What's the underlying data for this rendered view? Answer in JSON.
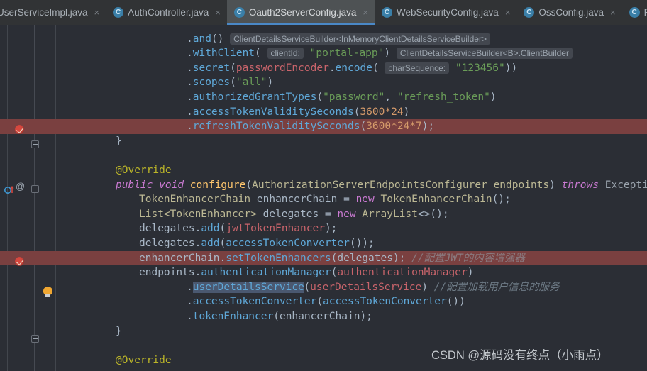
{
  "window": {
    "app": "IntelliJ IDEA",
    "theme_accent": "#4a88c7",
    "editor_background": "#2b2e35",
    "tabbar_background": "#313335",
    "breakpoint_line_color": "#7a4040"
  },
  "tabbar": {
    "tabs": [
      {
        "label": "UserServiceImpl.java",
        "icon": "java-class-icon",
        "icon_letter": "C",
        "active": false,
        "close_label": "×",
        "truncated_left": true
      },
      {
        "label": "AuthController.java",
        "icon": "java-class-icon",
        "icon_letter": "C",
        "active": false,
        "close_label": "×",
        "truncated_left": false
      },
      {
        "label": "Oauth2ServerConfig.java",
        "icon": "java-class-icon",
        "icon_letter": "C",
        "active": true,
        "close_label": "×",
        "truncated_left": false
      },
      {
        "label": "WebSecurityConfig.java",
        "icon": "java-class-icon",
        "icon_letter": "C",
        "active": false,
        "close_label": "×",
        "truncated_left": false
      },
      {
        "label": "OssConfig.java",
        "icon": "java-class-icon",
        "icon_letter": "C",
        "active": false,
        "close_label": "×",
        "truncated_left": false
      },
      {
        "label": "RedisConf",
        "icon": "java-class-icon",
        "icon_letter": "C",
        "active": false,
        "close_label": "",
        "truncated_left": false
      }
    ]
  },
  "editor": {
    "file": "Oauth2ServerConfig.java",
    "selected_token": "userDetailsService",
    "lines": [
      {
        "id": "line-and",
        "indent": 185,
        "tokens": [
          {
            "t": ".",
            "c": "t-punc"
          },
          {
            "t": "and",
            "c": "t-method"
          },
          {
            "t": "() ",
            "c": "t-punc"
          },
          {
            "t": "ClientDetailsServiceBuilder<InMemoryClientDetailsServiceBuilder>",
            "c": "chip-t"
          }
        ]
      },
      {
        "id": "line-withclient",
        "indent": 185,
        "tokens": [
          {
            "t": ".",
            "c": "t-punc"
          },
          {
            "t": "withClient",
            "c": "t-method"
          },
          {
            "t": "( ",
            "c": "t-punc"
          },
          {
            "t": "clientId:",
            "c": "chip"
          },
          {
            "t": " ",
            "c": "t-punc"
          },
          {
            "t": "\"portal-app\"",
            "c": "t-str"
          },
          {
            "t": ") ",
            "c": "t-punc"
          },
          {
            "t": "ClientDetailsServiceBuilder<B>.ClientBuilder",
            "c": "chip-t"
          }
        ]
      },
      {
        "id": "line-secret",
        "indent": 185,
        "tokens": [
          {
            "t": ".",
            "c": "t-punc"
          },
          {
            "t": "secret",
            "c": "t-method"
          },
          {
            "t": "(",
            "c": "t-punc"
          },
          {
            "t": "passwordEncoder",
            "c": "t-fieldred"
          },
          {
            "t": ".",
            "c": "t-punc"
          },
          {
            "t": "encode",
            "c": "t-method"
          },
          {
            "t": "( ",
            "c": "t-punc"
          },
          {
            "t": "charSequence:",
            "c": "chip"
          },
          {
            "t": " ",
            "c": "t-punc"
          },
          {
            "t": "\"123456\"",
            "c": "t-str"
          },
          {
            "t": "))",
            "c": "t-punc"
          }
        ]
      },
      {
        "id": "line-scopes",
        "indent": 185,
        "tokens": [
          {
            "t": ".",
            "c": "t-punc"
          },
          {
            "t": "scopes",
            "c": "t-method"
          },
          {
            "t": "(",
            "c": "t-punc"
          },
          {
            "t": "\"all\"",
            "c": "t-str"
          },
          {
            "t": ")",
            "c": "t-punc"
          }
        ]
      },
      {
        "id": "line-granttypes",
        "indent": 185,
        "tokens": [
          {
            "t": ".",
            "c": "t-punc"
          },
          {
            "t": "authorizedGrantTypes",
            "c": "t-method"
          },
          {
            "t": "(",
            "c": "t-punc"
          },
          {
            "t": "\"password\"",
            "c": "t-str"
          },
          {
            "t": ", ",
            "c": "t-punc"
          },
          {
            "t": "\"refresh_token\"",
            "c": "t-str"
          },
          {
            "t": ")",
            "c": "t-punc"
          }
        ]
      },
      {
        "id": "line-accesstokenvalidity",
        "indent": 185,
        "tokens": [
          {
            "t": ".",
            "c": "t-punc"
          },
          {
            "t": "accessTokenValiditySeconds",
            "c": "t-method"
          },
          {
            "t": "(",
            "c": "t-punc"
          },
          {
            "t": "3600*24",
            "c": "t-num"
          },
          {
            "t": ")",
            "c": "t-punc"
          }
        ]
      },
      {
        "id": "line-refreshtokenvalidity",
        "indent": 185,
        "breakpoint": true,
        "tokens": [
          {
            "t": ".",
            "c": "t-punc"
          },
          {
            "t": "refreshTokenValiditySeconds",
            "c": "t-method"
          },
          {
            "t": "(",
            "c": "t-punc"
          },
          {
            "t": "3600*24*7",
            "c": "t-num"
          },
          {
            "t": ");",
            "c": "t-punc"
          }
        ]
      },
      {
        "id": "line-closebrace-1",
        "indent": 85,
        "tokens": [
          {
            "t": "}",
            "c": "t-punc"
          }
        ]
      },
      {
        "id": "line-blank-1",
        "indent": 0,
        "tokens": []
      },
      {
        "id": "line-override-1",
        "indent": 85,
        "tokens": [
          {
            "t": "@Override",
            "c": "t-anno"
          }
        ]
      },
      {
        "id": "line-configure-sig",
        "indent": 85,
        "tokens": [
          {
            "t": "public",
            "c": "t-kw"
          },
          {
            "t": " ",
            "c": "t-punc"
          },
          {
            "t": "void",
            "c": "t-kw"
          },
          {
            "t": " ",
            "c": "t-punc"
          },
          {
            "t": "configure",
            "c": "t-methoddef"
          },
          {
            "t": "(",
            "c": "t-punc"
          },
          {
            "t": "AuthorizationServerEndpointsConfigurer",
            "c": "t-type"
          },
          {
            "t": " ",
            "c": "t-punc"
          },
          {
            "t": "endpoints",
            "c": "t-type"
          },
          {
            "t": ") ",
            "c": "t-punc"
          },
          {
            "t": "throws",
            "c": "t-kw"
          },
          {
            "t": " ",
            "c": "t-punc"
          },
          {
            "t": "Exception",
            "c": "t-grey"
          },
          {
            "t": " {",
            "c": "t-punc"
          }
        ]
      },
      {
        "id": "line-enhancerchain-decl",
        "indent": 118,
        "tokens": [
          {
            "t": "TokenEnhancerChain",
            "c": "t-type"
          },
          {
            "t": " ",
            "c": "t-punc"
          },
          {
            "t": "enhancerChain",
            "c": "t-ident"
          },
          {
            "t": " = ",
            "c": "t-punc"
          },
          {
            "t": "new",
            "c": "t-kw2"
          },
          {
            "t": " ",
            "c": "t-punc"
          },
          {
            "t": "TokenEnhancerChain",
            "c": "t-type"
          },
          {
            "t": "();",
            "c": "t-punc"
          }
        ]
      },
      {
        "id": "line-delegates-decl",
        "indent": 118,
        "tokens": [
          {
            "t": "List<TokenEnhancer>",
            "c": "t-type"
          },
          {
            "t": " ",
            "c": "t-punc"
          },
          {
            "t": "delegates",
            "c": "t-ident"
          },
          {
            "t": " = ",
            "c": "t-punc"
          },
          {
            "t": "new",
            "c": "t-kw2"
          },
          {
            "t": " ",
            "c": "t-punc"
          },
          {
            "t": "ArrayList",
            "c": "t-type"
          },
          {
            "t": "<>();",
            "c": "t-punc"
          }
        ]
      },
      {
        "id": "line-add-jwt",
        "indent": 118,
        "tokens": [
          {
            "t": "delegates",
            "c": "t-ident"
          },
          {
            "t": ".",
            "c": "t-punc"
          },
          {
            "t": "add",
            "c": "t-method"
          },
          {
            "t": "(",
            "c": "t-punc"
          },
          {
            "t": "jwtTokenEnhancer",
            "c": "t-fieldred"
          },
          {
            "t": ");",
            "c": "t-punc"
          }
        ]
      },
      {
        "id": "line-add-converter",
        "indent": 118,
        "tokens": [
          {
            "t": "delegates",
            "c": "t-ident"
          },
          {
            "t": ".",
            "c": "t-punc"
          },
          {
            "t": "add",
            "c": "t-method"
          },
          {
            "t": "(",
            "c": "t-punc"
          },
          {
            "t": "accessTokenConverter",
            "c": "t-method"
          },
          {
            "t": "());",
            "c": "t-punc"
          }
        ]
      },
      {
        "id": "line-settokenenhancers",
        "indent": 118,
        "breakpoint": true,
        "tokens": [
          {
            "t": "enhancerChain",
            "c": "t-ident"
          },
          {
            "t": ".",
            "c": "t-punc"
          },
          {
            "t": "setTokenEnhancers",
            "c": "t-method"
          },
          {
            "t": "(",
            "c": "t-punc"
          },
          {
            "t": "delegates",
            "c": "t-ident"
          },
          {
            "t": "); ",
            "c": "t-punc"
          },
          {
            "t": "//配置JWT的内容增强器",
            "c": "hl-comment"
          }
        ]
      },
      {
        "id": "line-authenticationmanager",
        "indent": 118,
        "tokens": [
          {
            "t": "endpoints",
            "c": "t-ident"
          },
          {
            "t": ".",
            "c": "t-punc"
          },
          {
            "t": "authenticationManager",
            "c": "t-method"
          },
          {
            "t": "(",
            "c": "t-punc"
          },
          {
            "t": "authenticationManager",
            "c": "t-fieldred"
          },
          {
            "t": ")",
            "c": "t-punc"
          }
        ]
      },
      {
        "id": "line-userdetailsservice",
        "indent": 185,
        "caretline": true,
        "tokens": [
          {
            "t": ".",
            "c": "t-punc"
          },
          {
            "t": "userDetailsService",
            "c": "sel"
          },
          {
            "t": "CARET",
            "c": "caret"
          },
          {
            "t": "(",
            "c": "t-punc"
          },
          {
            "t": "userDetailsService",
            "c": "t-fieldred"
          },
          {
            "t": ") ",
            "c": "t-punc"
          },
          {
            "t": "//配置加载用户信息的服务",
            "c": "hl-comment"
          }
        ]
      },
      {
        "id": "line-accesstokenconverter",
        "indent": 185,
        "tokens": [
          {
            "t": ".",
            "c": "t-punc"
          },
          {
            "t": "accessTokenConverter",
            "c": "t-method"
          },
          {
            "t": "(",
            "c": "t-punc"
          },
          {
            "t": "accessTokenConverter",
            "c": "t-method"
          },
          {
            "t": "())",
            "c": "t-punc"
          }
        ]
      },
      {
        "id": "line-tokenenhancer",
        "indent": 185,
        "tokens": [
          {
            "t": ".",
            "c": "t-punc"
          },
          {
            "t": "tokenEnhancer",
            "c": "t-method"
          },
          {
            "t": "(",
            "c": "t-punc"
          },
          {
            "t": "enhancerChain",
            "c": "t-ident"
          },
          {
            "t": ");",
            "c": "t-punc"
          }
        ]
      },
      {
        "id": "line-closebrace-2",
        "indent": 85,
        "tokens": [
          {
            "t": "}",
            "c": "t-punc"
          }
        ]
      },
      {
        "id": "line-blank-2",
        "indent": 0,
        "tokens": []
      },
      {
        "id": "line-override-2",
        "indent": 85,
        "tokens": [
          {
            "t": "@Override",
            "c": "t-anno"
          }
        ]
      }
    ],
    "gutter": {
      "breakpoint_icon": "breakpoint-verified-icon",
      "fold_icon": "code-fold-icon",
      "override_icon": "overriding-method-icon",
      "annotation_icon": "annotation-icon",
      "annotation_glyph": "@",
      "intention_icon": "lightbulb-intention-icon"
    }
  },
  "watermark": {
    "text": "CSDN @源码没有终点（小雨点）"
  }
}
